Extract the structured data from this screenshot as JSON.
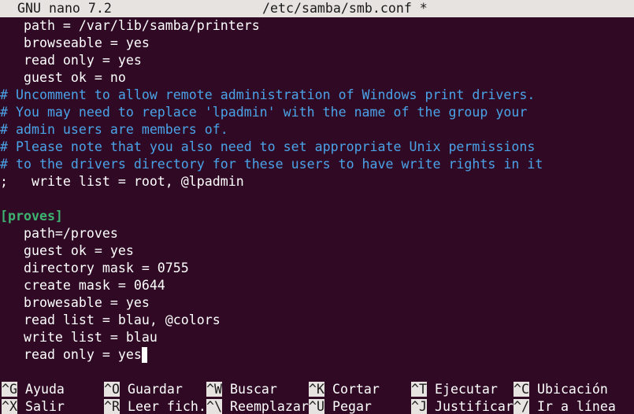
{
  "titlebar": {
    "app": "GNU nano 7.2",
    "file": "/etc/samba/smb.conf *"
  },
  "editor": {
    "lines": [
      {
        "text": "   path = /var/lib/samba/printers",
        "type": "normal"
      },
      {
        "text": "   browseable = yes",
        "type": "normal"
      },
      {
        "text": "   read only = yes",
        "type": "normal"
      },
      {
        "text": "   guest ok = no",
        "type": "normal"
      },
      {
        "text": "# Uncomment to allow remote administration of Windows print drivers.",
        "type": "comment"
      },
      {
        "text": "# You may need to replace 'lpadmin' with the name of the group your",
        "type": "comment"
      },
      {
        "text": "# admin users are members of.",
        "type": "comment"
      },
      {
        "text": "# Please note that you also need to set appropriate Unix permissions",
        "type": "comment"
      },
      {
        "text": "# to the drivers directory for these users to have write rights in it",
        "type": "comment"
      },
      {
        "text": ";   write list = root, @lpadmin",
        "type": "normal"
      },
      {
        "text": "",
        "type": "normal"
      },
      {
        "text": "[proves]",
        "type": "section"
      },
      {
        "text": "   path=/proves",
        "type": "normal"
      },
      {
        "text": "   guest ok = yes",
        "type": "normal"
      },
      {
        "text": "   directory mask = 0755",
        "type": "normal"
      },
      {
        "text": "   create mask = 0644",
        "type": "normal"
      },
      {
        "text": "   browesable = yes",
        "type": "normal"
      },
      {
        "text": "   read list = blau, @colors",
        "type": "normal"
      },
      {
        "text": "   write list = blau",
        "type": "normal"
      },
      {
        "text": "   read only = yes",
        "type": "normal",
        "cursor": true
      }
    ]
  },
  "shortcuts": {
    "row1": [
      {
        "key": "^G",
        "label": " Ayuda"
      },
      {
        "key": "^O",
        "label": " Guardar"
      },
      {
        "key": "^W",
        "label": " Buscar"
      },
      {
        "key": "^K",
        "label": " Cortar"
      },
      {
        "key": "^T",
        "label": " Ejecutar"
      },
      {
        "key": "^C",
        "label": " Ubicación"
      }
    ],
    "row2": [
      {
        "key": "^X",
        "label": " Salir"
      },
      {
        "key": "^R",
        "label": " Leer fich."
      },
      {
        "key": "^\\",
        "label": " Reemplazar"
      },
      {
        "key": "^U",
        "label": " Pegar"
      },
      {
        "key": "^J",
        "label": " Justificar"
      },
      {
        "key": "^/",
        "label": " Ir a línea"
      }
    ]
  },
  "colors": {
    "background": "#300a24",
    "comment": "#4aa3e8",
    "section": "#3cb371",
    "bar": "#e6e3e0"
  }
}
